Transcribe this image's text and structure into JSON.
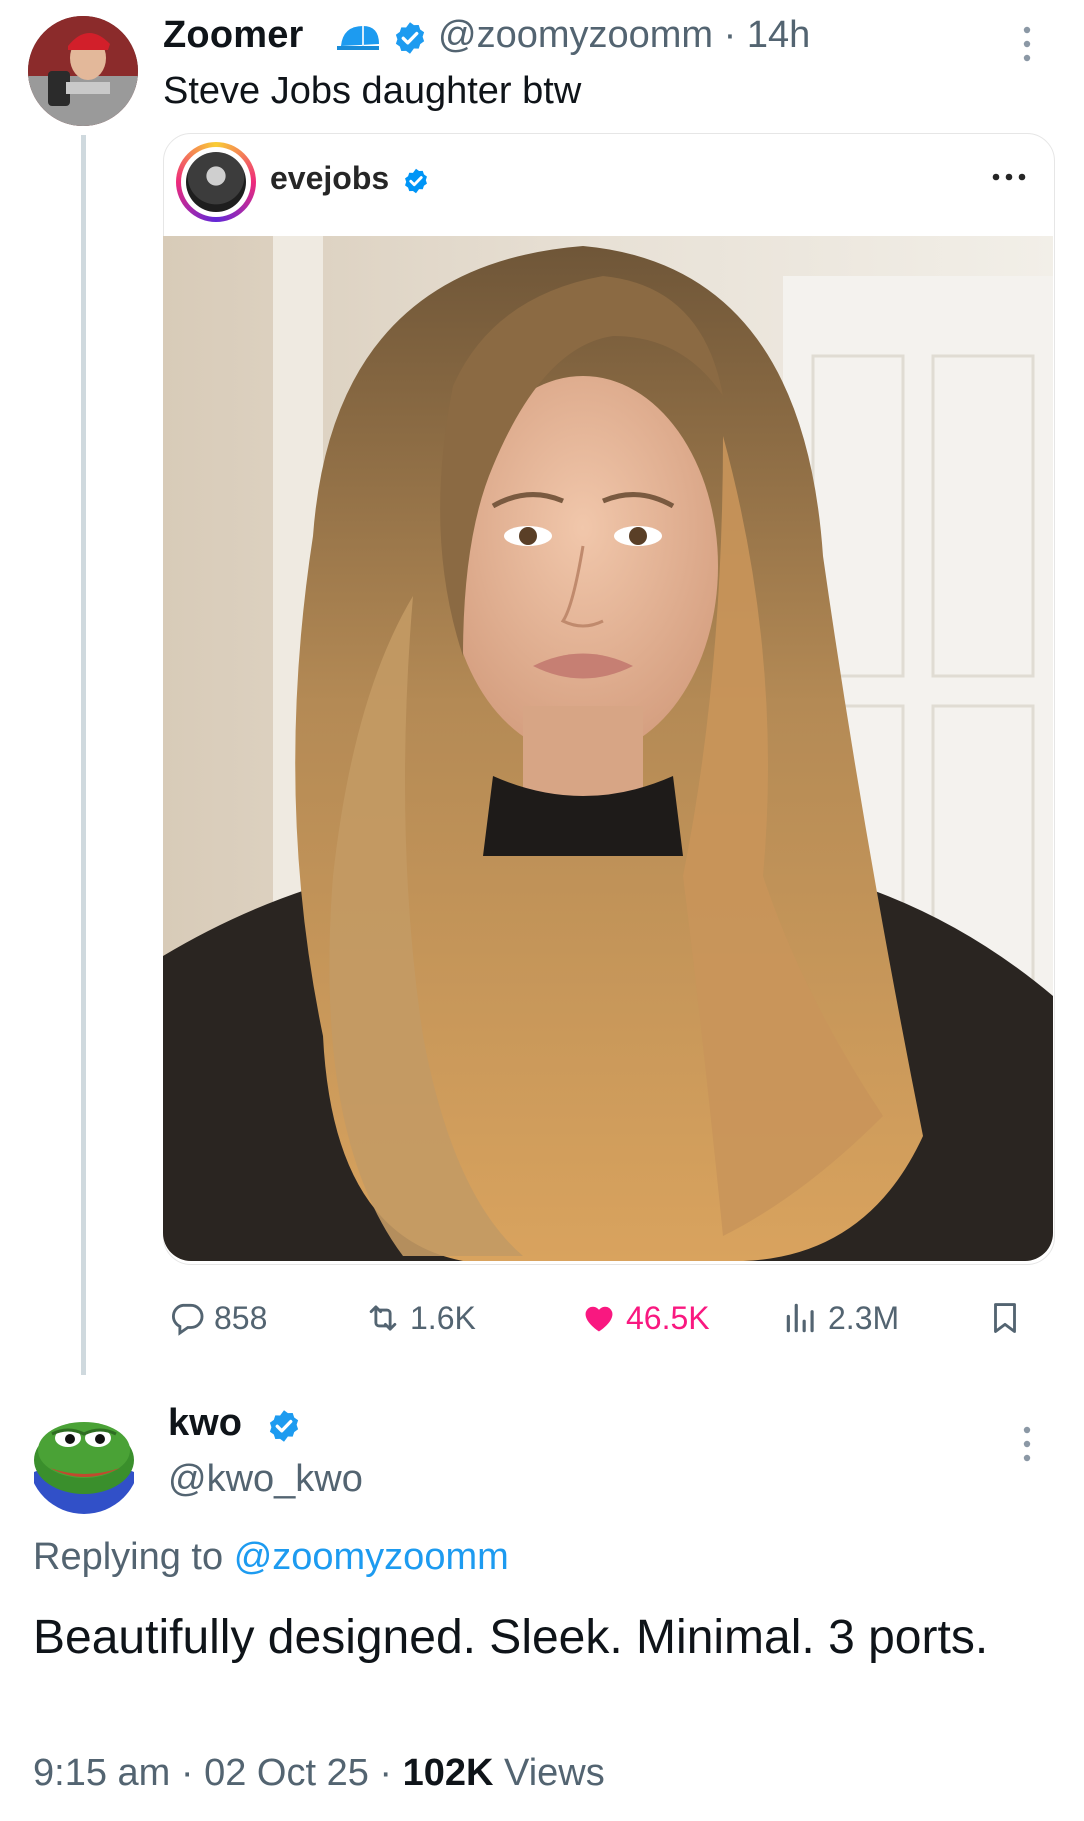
{
  "tweet": {
    "author_name": "Zoomer",
    "author_handle": "@zoomyzoomm",
    "time_ago": "14h",
    "text": "Steve Jobs daughter btw",
    "embed": {
      "platform": "instagram",
      "account": "evejobs"
    },
    "stats": {
      "replies": "858",
      "retweets": "1.6K",
      "likes": "46.5K",
      "views": "2.3M"
    }
  },
  "reply": {
    "author_name": "kwo",
    "author_handle": "@kwo_kwo",
    "replying_prefix": "Replying to",
    "replying_to": "@zoomyzoomm",
    "text": "Beautifully designed. Sleek. Minimal. 3 ports.",
    "time": "9:15 am",
    "date": "02 Oct 25",
    "views_count": "102K",
    "views_label": "Views"
  },
  "colors": {
    "verified_blue": "#1d9bf0",
    "like_pink": "#f91880",
    "secondary_text": "#536471"
  },
  "icons": [
    "cap-icon",
    "verified-icon",
    "more-icon",
    "reply-icon",
    "retweet-icon",
    "like-icon",
    "views-icon",
    "bookmark-icon"
  ]
}
